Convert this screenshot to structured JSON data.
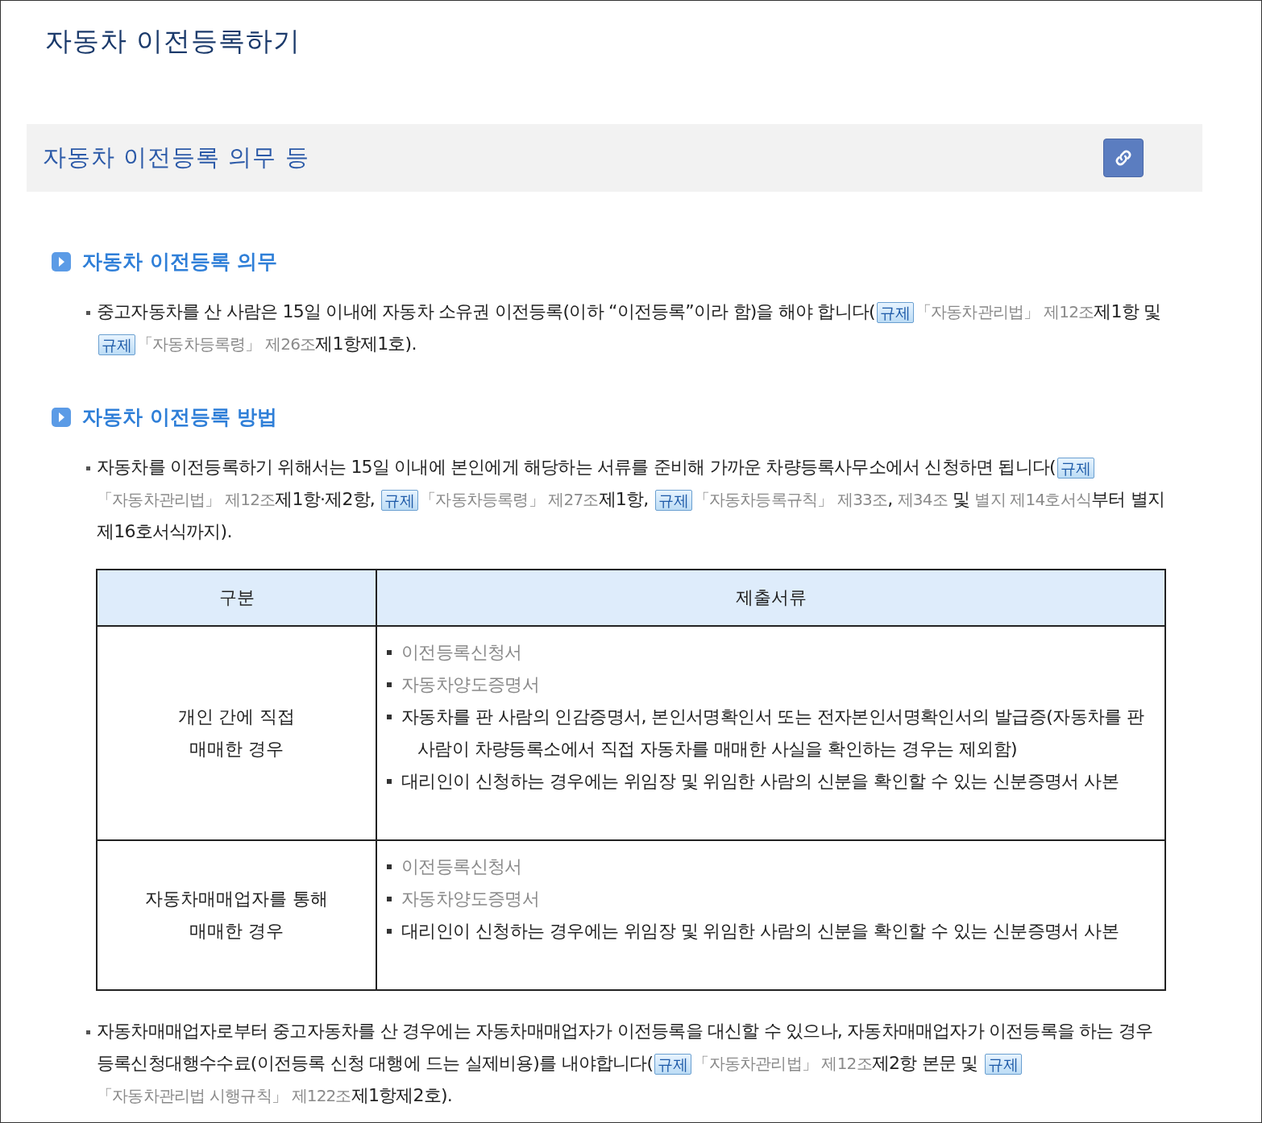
{
  "page_title": "자동차 이전등록하기",
  "section": {
    "title": "자동차 이전등록 의무 등"
  },
  "blocks": [
    {
      "kind": "heading",
      "text": "자동차 이전등록 의무"
    },
    {
      "kind": "paragraph",
      "segments": [
        {
          "kind": "text",
          "text": "중고자동차를 산 사람은 15일 이내에 자동차 소유권 이전등록(이하 “이전등록”이라 함)을 해야 합니다("
        },
        {
          "kind": "badge",
          "text": "규제"
        },
        {
          "kind": "link",
          "text": "「자동차관리법」 제12조"
        },
        {
          "kind": "text",
          "text": "제1항 및 "
        },
        {
          "kind": "badge",
          "text": "규제"
        },
        {
          "kind": "link",
          "text": "「자동차등록령」 제26조"
        },
        {
          "kind": "text",
          "text": "제1항제1호)."
        }
      ]
    },
    {
      "kind": "heading",
      "text": "자동차 이전등록 방법"
    },
    {
      "kind": "paragraph",
      "segments": [
        {
          "kind": "text",
          "text": "자동차를 이전등록하기 위해서는 15일 이내에 본인에게 해당하는 서류를 준비해 가까운 차량등록사무소에서 신청하면 됩니다("
        },
        {
          "kind": "badge",
          "text": "규제"
        },
        {
          "kind": "link",
          "text": "「자동차관리법」 제12조"
        },
        {
          "kind": "text",
          "text": "제1항·제2항, "
        },
        {
          "kind": "badge",
          "text": "규제"
        },
        {
          "kind": "link",
          "text": "「자동차등록령」 제27조"
        },
        {
          "kind": "text",
          "text": "제1항, "
        },
        {
          "kind": "badge",
          "text": "규제"
        },
        {
          "kind": "link",
          "text": "「자동차등록규칙」 제33조"
        },
        {
          "kind": "text",
          "text": ", "
        },
        {
          "kind": "link",
          "text": "제34조"
        },
        {
          "kind": "text",
          "text": " 및 "
        },
        {
          "kind": "link",
          "text": "별지 제14호서식"
        },
        {
          "kind": "text",
          "text": "부터 별지 제16호서식까지)."
        }
      ]
    },
    {
      "kind": "table",
      "columns": [
        "구분",
        "제출서류"
      ],
      "rows": [
        {
          "category": [
            "개인 간에 직접",
            "매매한 경우"
          ],
          "items": [
            {
              "kind": "link",
              "text": "이전등록신청서"
            },
            {
              "kind": "link",
              "text": "자동차양도증명서"
            },
            {
              "kind": "text",
              "text": "자동차를 판 사람의 인감증명서, 본인서명확인서 또는 전자본인서명확인서의 발급증(자동차를 판 사람이 차량등록소에서 직접 자동차를 매매한 사실을 확인하는 경우는 제외함)"
            },
            {
              "kind": "text",
              "text": "대리인이 신청하는 경우에는 위임장 및 위임한 사람의 신분을 확인할 수 있는 신분증명서 사본"
            }
          ]
        },
        {
          "category": [
            "자동차매매업자를 통해",
            "매매한 경우"
          ],
          "items": [
            {
              "kind": "link",
              "text": "이전등록신청서"
            },
            {
              "kind": "link",
              "text": "자동차양도증명서"
            },
            {
              "kind": "text",
              "text": "대리인이 신청하는 경우에는 위임장 및 위임한 사람의 신분을 확인할 수 있는 신분증명서 사본"
            }
          ]
        }
      ]
    },
    {
      "kind": "paragraph",
      "segments": [
        {
          "kind": "text",
          "text": "자동차매매업자로부터 중고자동차를 산 경우에는 자동차매매업자가 이전등록을 대신할 수 있으나, 자동차매매업자가 이전등록을 하는 경우 등록신청대행수수료(이전등록 신청 대행에 드는 실제비용)를 내야합니다("
        },
        {
          "kind": "badge",
          "text": "규제"
        },
        {
          "kind": "link",
          "text": "「자동차관리법」 제12조"
        },
        {
          "kind": "text",
          "text": "제2항 본문 및 "
        },
        {
          "kind": "badge",
          "text": "규제"
        },
        {
          "kind": "link",
          "text": "「자동차관리법 시행규칙」 제122조"
        },
        {
          "kind": "text",
          "text": "제1항제2호)."
        }
      ]
    }
  ]
}
